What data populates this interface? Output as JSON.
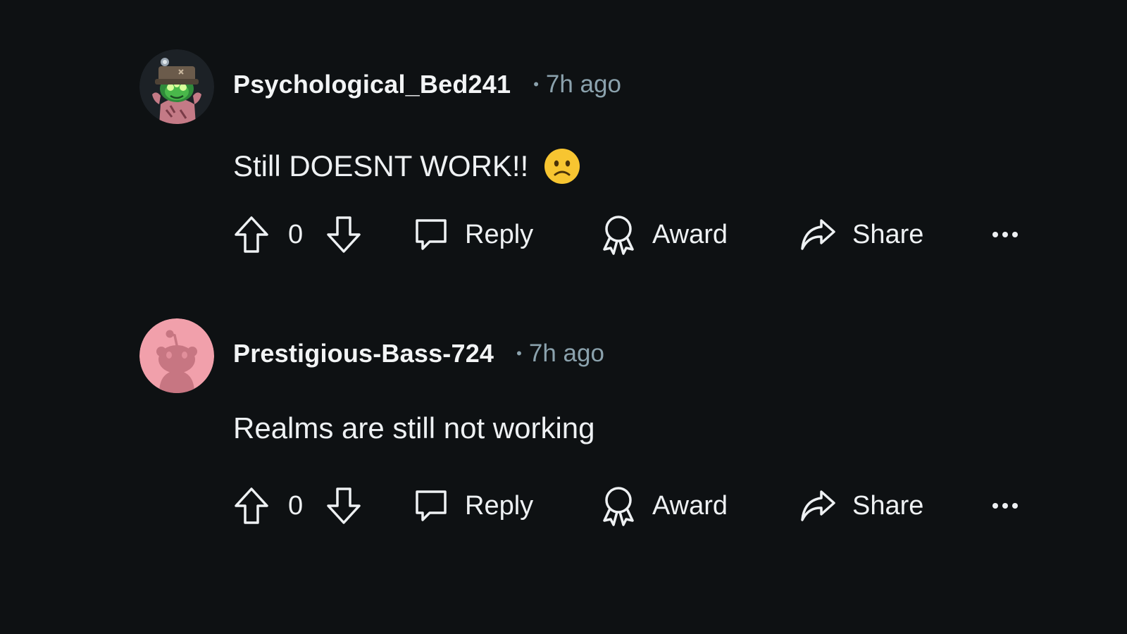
{
  "comments": [
    {
      "username": "Psychological_Bed241",
      "separator": "•",
      "time": "7h ago",
      "text": "Still DOESNT WORK!!",
      "emoji": "slightly-frowning-face",
      "score": "0",
      "actions": {
        "reply": "Reply",
        "award": "Award",
        "share": "Share",
        "more": "..."
      }
    },
    {
      "username": "Prestigious-Bass-724",
      "separator": "•",
      "time": "7h ago",
      "text": "Realms are still not working",
      "score": "0",
      "actions": {
        "reply": "Reply",
        "award": "Award",
        "share": "Share",
        "more": "..."
      }
    }
  ],
  "icons": {
    "upvote": "arrow-up-icon",
    "downvote": "arrow-down-icon",
    "reply": "comment-bubble-icon",
    "award": "award-ribbon-icon",
    "share": "share-arrow-icon",
    "more": "ellipsis-icon"
  },
  "colors": {
    "background": "#0e1113",
    "text": "#eef1f3",
    "meta": "#8ba2ad",
    "avatar_pink": "#f1a0ab"
  }
}
